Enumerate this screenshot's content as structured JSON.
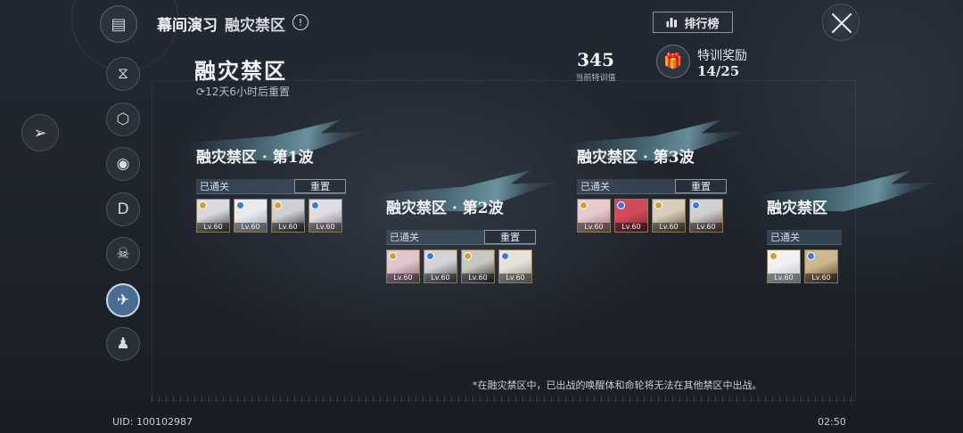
{
  "header": {
    "title": "幕间演习",
    "subtitle": "融灾禁区",
    "info_symbol": "!",
    "rank_label": "排行榜"
  },
  "zone": {
    "name": "融灾禁区",
    "timer": "12天6小时后重置",
    "score_value": "345",
    "score_label": "当前特训值",
    "reward_label": "特训奖励",
    "reward_count": "14/25"
  },
  "sidebar": {
    "items": [
      {
        "name": "dna-icon",
        "glyph": "⧖"
      },
      {
        "name": "hexagon-icon",
        "glyph": "⬡"
      },
      {
        "name": "eye-slash-icon",
        "glyph": "◉"
      },
      {
        "name": "calendar-d-icon",
        "glyph": "D"
      },
      {
        "name": "skull-icon",
        "glyph": "☠"
      },
      {
        "name": "bird-icon",
        "glyph": "✈"
      },
      {
        "name": "user-clock-icon",
        "glyph": "♟"
      }
    ],
    "active_index": 5
  },
  "waves": [
    {
      "title": "融灾禁区 · 第1波",
      "status": "已通关",
      "reset_label": "重置",
      "characters": [
        {
          "level": "Lv.60",
          "colors": [
            "#d9d9de",
            "#3a3a44"
          ]
        },
        {
          "level": "Lv.60",
          "colors": [
            "#e7ebf0",
            "#8d9aa8"
          ]
        },
        {
          "level": "Lv.60",
          "colors": [
            "#cfd0d4",
            "#2b2b31"
          ]
        },
        {
          "level": "Lv.60",
          "colors": [
            "#e0dde2",
            "#6f6678"
          ]
        }
      ]
    },
    {
      "title": "融灾禁区 · 第2波",
      "status": "已通关",
      "reset_label": "重置",
      "characters": [
        {
          "level": "Lv.60",
          "colors": [
            "#e2c6cf",
            "#7a5c6a"
          ]
        },
        {
          "level": "Lv.60",
          "colors": [
            "#d4d4d8",
            "#4b4d55"
          ]
        },
        {
          "level": "Lv.60",
          "colors": [
            "#c9c7c2",
            "#2c2c30"
          ]
        },
        {
          "level": "Lv.60",
          "colors": [
            "#e6e2da",
            "#8e8676"
          ]
        }
      ]
    },
    {
      "title": "融灾禁区 · 第3波",
      "status": "已通关",
      "reset_label": "重置",
      "characters": [
        {
          "level": "Lv.60",
          "colors": [
            "#e9c9cf",
            "#9a6e78"
          ]
        },
        {
          "level": "Lv.60",
          "colors": [
            "#d34a5c",
            "#6d2a33"
          ]
        },
        {
          "level": "Lv.60",
          "colors": [
            "#d8cdb9",
            "#5a4b3a"
          ]
        },
        {
          "level": "Lv.60",
          "colors": [
            "#cfcfcf",
            "#5c3c3c"
          ]
        }
      ]
    },
    {
      "title": "融灾禁区",
      "status": "已通关",
      "reset_label": "",
      "characters": [
        {
          "level": "Lv.60",
          "colors": [
            "#f0f0f2",
            "#b8bcc4"
          ]
        },
        {
          "level": "Lv.60",
          "colors": [
            "#cdb792",
            "#4a3a26"
          ]
        }
      ]
    }
  ],
  "footer": {
    "note": "*在融灾禁区中，已出战的唤醒体和命轮将无法在其他禁区中出战。",
    "uid": "UID: 100102987",
    "clock": "02:50"
  },
  "colors": {
    "background": "#1e232b",
    "active_tab": "#4a6c93",
    "banner": "#78b4c8"
  }
}
